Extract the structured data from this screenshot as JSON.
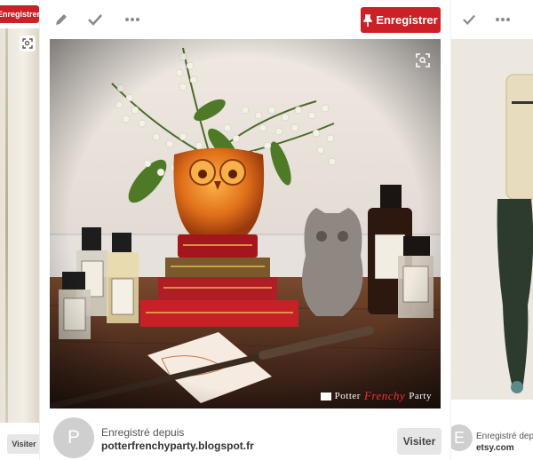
{
  "left_card": {
    "save_label": "Enregistrer",
    "visit_label": "Visiter"
  },
  "main_card": {
    "toolbar": {
      "edit_icon": "pencil-icon",
      "done_icon": "check-icon",
      "more_icon": "more-icon",
      "save_label": "Enregistrer",
      "save_icon": "pushpin-icon"
    },
    "image": {
      "watermark_part1": "Potter",
      "watermark_part2": "Frenchy",
      "watermark_part3": "Party",
      "zoom_icon": "zoom-icon"
    },
    "attribution": {
      "avatar_letter": "P",
      "saved_from_label": "Enregistré depuis",
      "source": "potterfrenchyparty.blogspot.fr",
      "visit_label": "Visiter"
    }
  },
  "right_card": {
    "avatar_letter": "E",
    "saved_from_label": "Enregistré depu",
    "source": "etsy.com"
  },
  "colors": {
    "save_button": "#cb2027",
    "background": "#efefef"
  }
}
